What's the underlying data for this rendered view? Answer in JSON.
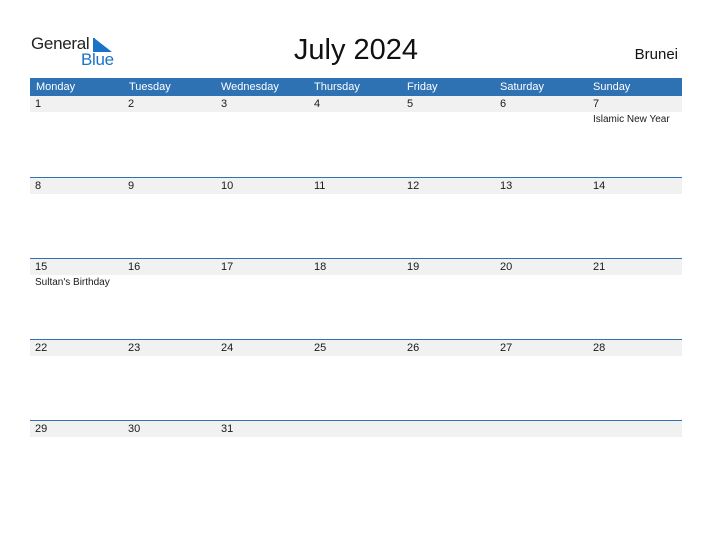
{
  "logo": {
    "word1": "General",
    "word2": "Blue",
    "accent_color": "#1a73c8"
  },
  "title": "July 2024",
  "country": "Brunei",
  "colors": {
    "header_bg": "#2e72b4",
    "strip_bg": "#f1f1f1"
  },
  "weekdays": [
    "Monday",
    "Tuesday",
    "Wednesday",
    "Thursday",
    "Friday",
    "Saturday",
    "Sunday"
  ],
  "weeks": [
    [
      {
        "day": "1",
        "holiday": ""
      },
      {
        "day": "2",
        "holiday": ""
      },
      {
        "day": "3",
        "holiday": ""
      },
      {
        "day": "4",
        "holiday": ""
      },
      {
        "day": "5",
        "holiday": ""
      },
      {
        "day": "6",
        "holiday": ""
      },
      {
        "day": "7",
        "holiday": "Islamic New Year"
      }
    ],
    [
      {
        "day": "8",
        "holiday": ""
      },
      {
        "day": "9",
        "holiday": ""
      },
      {
        "day": "10",
        "holiday": ""
      },
      {
        "day": "11",
        "holiday": ""
      },
      {
        "day": "12",
        "holiday": ""
      },
      {
        "day": "13",
        "holiday": ""
      },
      {
        "day": "14",
        "holiday": ""
      }
    ],
    [
      {
        "day": "15",
        "holiday": "Sultan's Birthday"
      },
      {
        "day": "16",
        "holiday": ""
      },
      {
        "day": "17",
        "holiday": ""
      },
      {
        "day": "18",
        "holiday": ""
      },
      {
        "day": "19",
        "holiday": ""
      },
      {
        "day": "20",
        "holiday": ""
      },
      {
        "day": "21",
        "holiday": ""
      }
    ],
    [
      {
        "day": "22",
        "holiday": ""
      },
      {
        "day": "23",
        "holiday": ""
      },
      {
        "day": "24",
        "holiday": ""
      },
      {
        "day": "25",
        "holiday": ""
      },
      {
        "day": "26",
        "holiday": ""
      },
      {
        "day": "27",
        "holiday": ""
      },
      {
        "day": "28",
        "holiday": ""
      }
    ],
    [
      {
        "day": "29",
        "holiday": ""
      },
      {
        "day": "30",
        "holiday": ""
      },
      {
        "day": "31",
        "holiday": ""
      },
      {
        "day": "",
        "holiday": ""
      },
      {
        "day": "",
        "holiday": ""
      },
      {
        "day": "",
        "holiday": ""
      },
      {
        "day": "",
        "holiday": ""
      }
    ]
  ]
}
